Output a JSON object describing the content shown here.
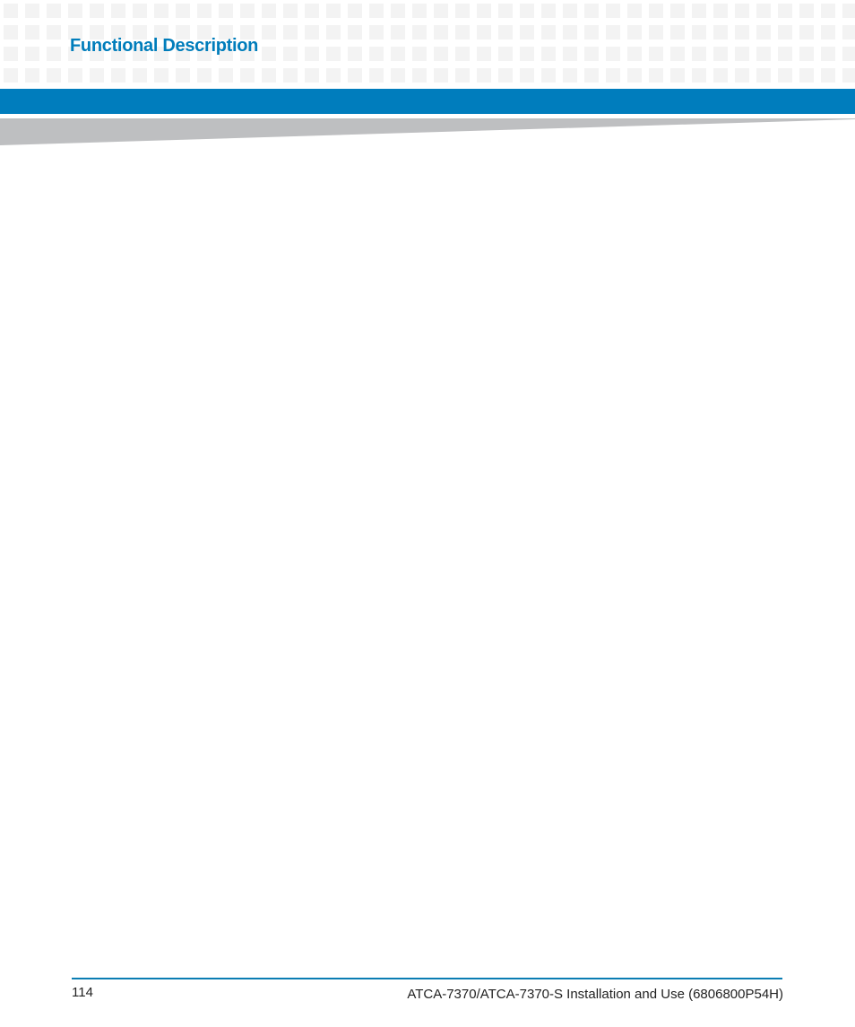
{
  "header": {
    "section_title": "Functional Description"
  },
  "colors": {
    "accent_blue": "#007dbb",
    "band_blue": "#007dbd",
    "wedge_gray": "#bebfc1",
    "grid_square": "#f3f3f3",
    "footer_rule": "#0a7db3"
  },
  "footer": {
    "page_number": "114",
    "document_title": "ATCA-7370/ATCA-7370-S Installation and Use (6806800P54H)"
  }
}
